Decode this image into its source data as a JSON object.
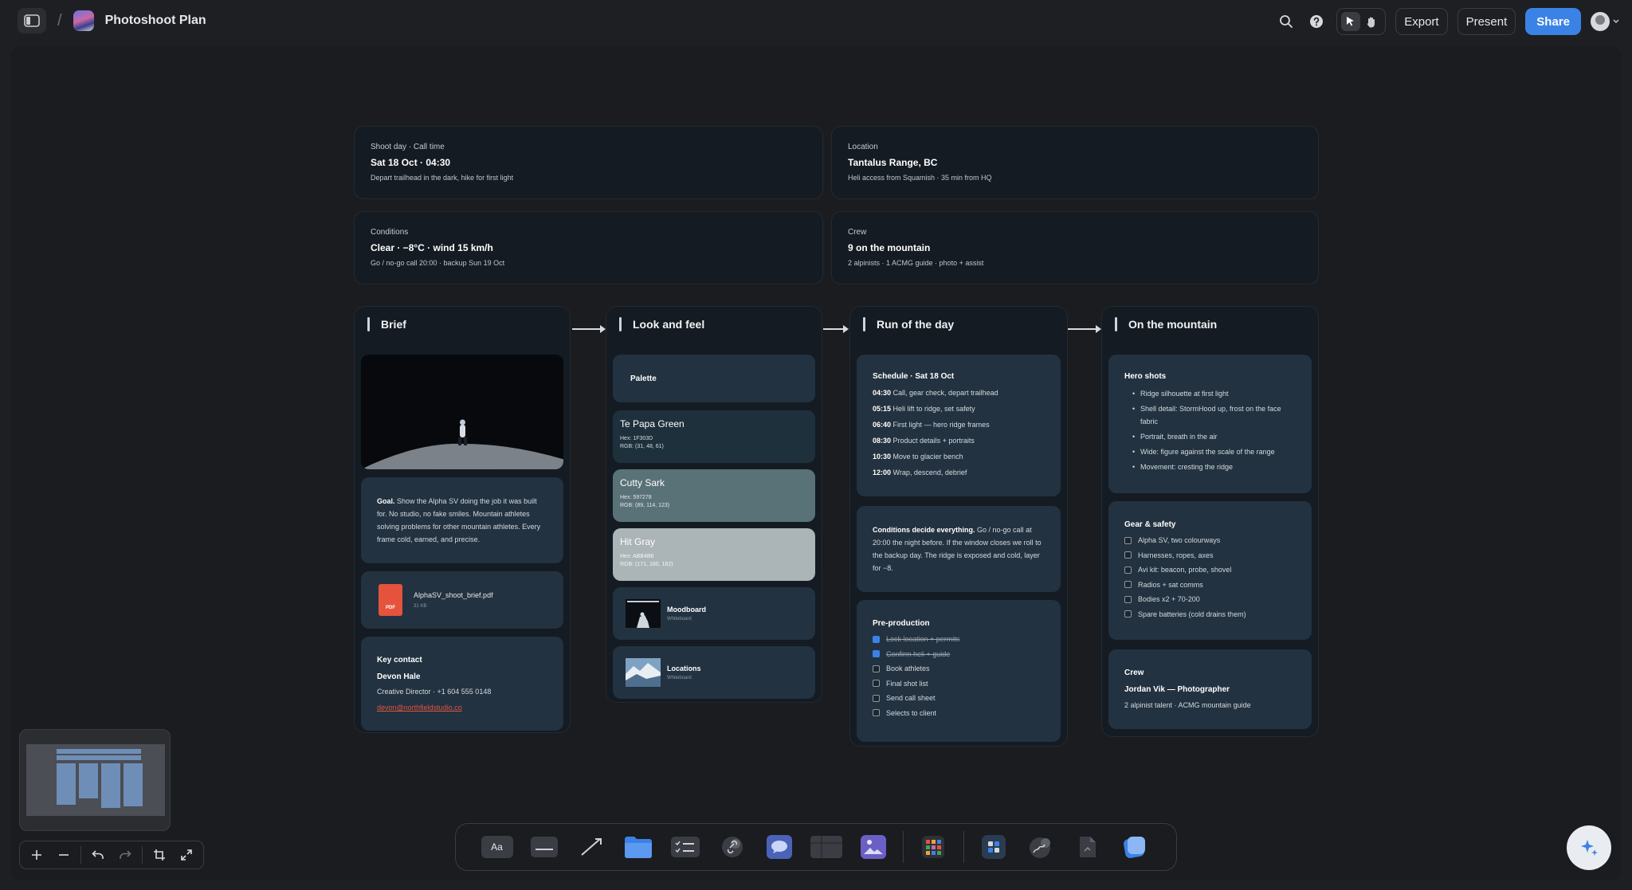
{
  "app": {
    "title": "Photoshoot Plan",
    "breadcrumb_sep": "/"
  },
  "toolbar": {
    "export": "Export",
    "present": "Present",
    "share": "Share"
  },
  "info_cards": [
    {
      "label": "Shoot day · Call time",
      "value": "Sat 18 Oct · 04:30",
      "sub": "Depart trailhead in the dark, hike for first light"
    },
    {
      "label": "Location",
      "value": "Tantalus Range, BC",
      "sub": "Heli access from Squamish · 35 min from HQ"
    },
    {
      "label": "Conditions",
      "value": "Clear · −8°C · wind 15 km/h",
      "sub": "Go / no-go call 20:00 · backup Sun 19 Oct"
    },
    {
      "label": "Crew",
      "value": "9 on the mountain",
      "sub": "2 alpinists · 1 ACMG guide · photo + assist"
    }
  ],
  "columns": {
    "brief": {
      "title": "Brief",
      "goal_lead": "Goal.",
      "goal_text": " Show the Alpha SV doing the job it was built for. No studio, no fake smiles. Mountain athletes solving problems for other mountain athletes. Every frame cold, earned, and precise.",
      "file_name": "AlphaSV_shoot_brief.pdf",
      "file_size": "31 KB",
      "file_badge": "PDF",
      "contact_heading": "Key contact",
      "contact_name": "Devon Hale",
      "contact_role": "Creative Director · +1 604 555 0148",
      "contact_email": "devon@northfieldstudio.co"
    },
    "look": {
      "title": "Look and feel",
      "palette_label": "Palette",
      "swatches": [
        {
          "name": "Te Papa Green",
          "hex": "Hex: 1F303D",
          "rgb": "RGB: (31, 48, 61)",
          "color": "#1f303d"
        },
        {
          "name": "Cutty Sark",
          "hex": "Hex: 597278",
          "rgb": "RGB: (89, 114, 123)",
          "color": "#597278"
        },
        {
          "name": "Hit Gray",
          "hex": "Hex: ABB4B6",
          "rgb": "RGB: (171, 180, 182)",
          "color": "#abb4b6"
        }
      ],
      "links": [
        {
          "title": "Moodboard",
          "sub": "Whiteboard"
        },
        {
          "title": "Locations",
          "sub": "Whiteboard"
        }
      ]
    },
    "run": {
      "title": "Run of the day",
      "schedule_heading": "Schedule · Sat 18 Oct",
      "schedule": [
        {
          "time": "04:30",
          "text": " Call, gear check, depart trailhead"
        },
        {
          "time": "05:15",
          "text": " Heli lift to ridge, set safety"
        },
        {
          "time": "06:40",
          "text": " First light — hero ridge frames"
        },
        {
          "time": "08:30",
          "text": " Product details + portraits"
        },
        {
          "time": "10:30",
          "text": " Move to glacier bench"
        },
        {
          "time": "12:00",
          "text": " Wrap, descend, debrief"
        }
      ],
      "conditions_lead": "Conditions decide everything.",
      "conditions_text": " Go / no-go call at 20:00 the night before. If the window closes we roll to the backup day. The ridge is exposed and cold, layer for −8.",
      "preprod_heading": "Pre-production",
      "preprod": [
        {
          "text": "Lock location + permits",
          "done": true
        },
        {
          "text": "Confirm heli + guide",
          "done": true
        },
        {
          "text": "Book athletes",
          "done": false
        },
        {
          "text": "Final shot list",
          "done": false
        },
        {
          "text": "Send call sheet",
          "done": false
        },
        {
          "text": "Selects to client",
          "done": false
        }
      ]
    },
    "mountain": {
      "title": "On the mountain",
      "hero_heading": "Hero shots",
      "hero": [
        "Ridge silhouette at first light",
        "Shell detail: StormHood up, frost on the face fabric",
        "Portrait, breath in the air",
        "Wide: figure against the scale of the range",
        "Movement: cresting the ridge"
      ],
      "gear_heading": "Gear & safety",
      "gear": [
        "Alpha SV, two colourways",
        "Harnesses, ropes, axes",
        "Avi kit: beacon, probe, shovel",
        "Radios + sat comms",
        "Bodies x2 + 70-200",
        "Spare batteries (cold drains them)"
      ],
      "crew_heading": "Crew",
      "crew_name": "Jordan Vik — Photographer",
      "crew_sub": "2 alpinist talent · ACMG mountain guide"
    }
  },
  "dock": {
    "text_tool_label": "Aa"
  },
  "colors": {
    "accent": "#3b82e6",
    "card": "#223240",
    "panel": "#141b22",
    "pdf": "#e5533d"
  }
}
